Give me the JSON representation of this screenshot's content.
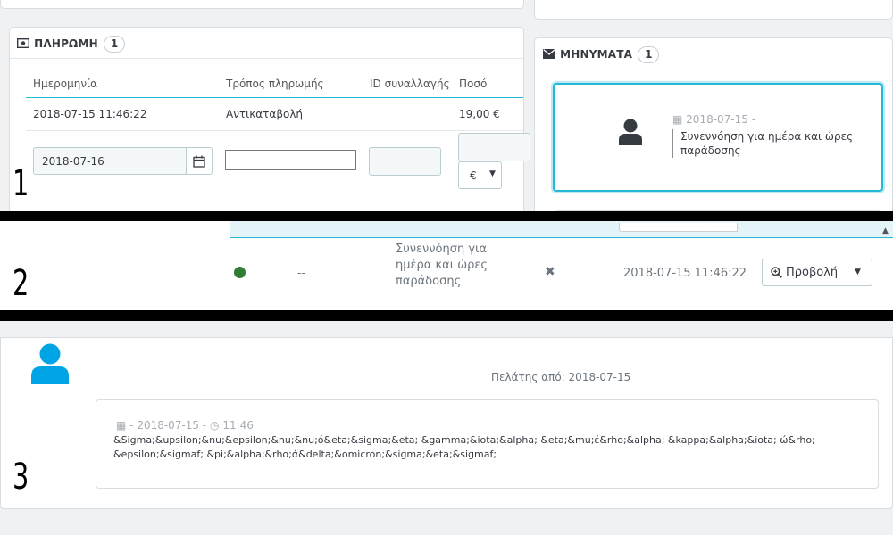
{
  "step_labels": [
    "1",
    "2",
    "3"
  ],
  "payment": {
    "title": "ΠΛΗΡΩΜΗ",
    "count": "1",
    "columns": [
      "Ημερομηνία",
      "Τρόπος πληρωμής",
      "ID συναλλαγής",
      "Ποσό"
    ],
    "row": {
      "date": "2018-07-15 11:46:22",
      "method": "Αντικαταβολή",
      "amount": "19,00 €"
    },
    "form": {
      "date_value": "2018-07-16",
      "currency": "€"
    }
  },
  "messages": {
    "title": "ΜΗΝΥΜΑΤΑ",
    "count": "1",
    "item": {
      "date": "2018-07-15 -",
      "text": "Συνεννόηση για ημέρα και ώρες παράδοσης"
    }
  },
  "row2": {
    "status_dash": "--",
    "message": "Συνεννόηση για ημέρα και ώρες παράδοσης",
    "date": "2018-07-15 11:46:22",
    "view_label": "Προβολή"
  },
  "thread": {
    "customer_since": "Πελάτης από: 2018-07-15",
    "meta_date": "- 2018-07-15 -",
    "meta_time": "11:46",
    "body": "&Sigma;&upsilon;&nu;&epsilon;&nu;&nu;ό&eta;&sigma;&eta; &gamma;&iota;&alpha; &eta;&mu;έ&rho;&alpha; &kappa;&alpha;&iota; ώ&rho;&epsilon;&sigmaf; &pi;&alpha;&rho;ά&delta;&omicron;&sigma;&eta;&sigmaf;"
  },
  "colors": {
    "accent": "#25b9d7",
    "status_green": "#2e7d32",
    "avatar_dark": "#363a41",
    "avatar_blue": "#00a4e4"
  }
}
